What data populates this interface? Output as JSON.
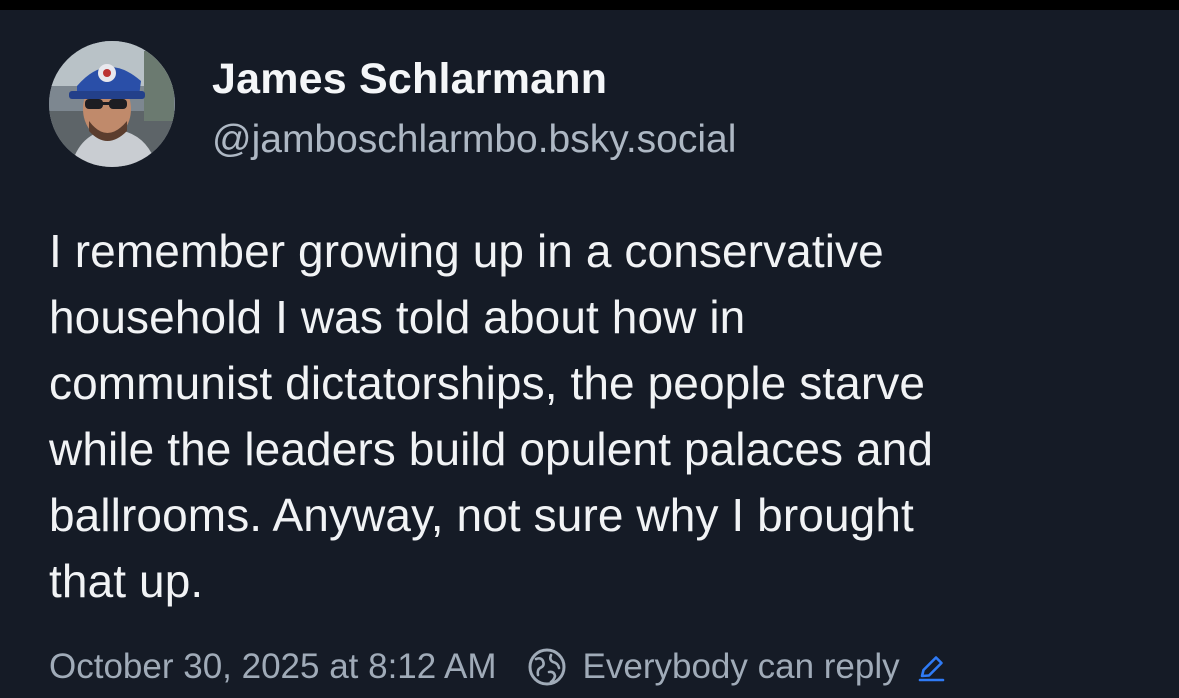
{
  "post": {
    "author": {
      "display_name": "James Schlarmann",
      "handle": "@jamboschlarmbo.bsky.social"
    },
    "text": "I remember growing up in a conservative\nhousehold I was told about how in\ncommunist dictatorships, the people starve\nwhile the leaders build opulent palaces and\nballrooms. Anyway, not sure why I brought\nthat up.",
    "timestamp": "October 30, 2025 at 8:12 AM",
    "reply_setting": "Everybody can reply",
    "icons": {
      "globe": "globe-icon",
      "edit": "pencil-icon"
    }
  },
  "colors": {
    "background": "#151b26",
    "text": "#f1f3f5",
    "muted": "#a0abb8",
    "accent": "#2f7bf6"
  }
}
